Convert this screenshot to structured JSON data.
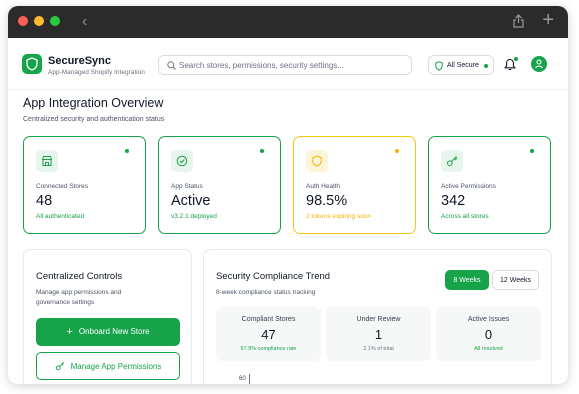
{
  "app": {
    "name": "SecureSync",
    "tagline": "App-Managed Shopify Integration",
    "search_placeholder": "Search stores, permissions, security settings...",
    "status_label": "All Secure",
    "accent": "#16a34a",
    "warning": "#f5b400"
  },
  "overview": {
    "title": "App Integration Overview",
    "subtitle": "Centralized security and authentication status",
    "cards": [
      {
        "icon": "store-icon",
        "label": "Connected Stores",
        "value": "48",
        "sub": "All authenticated",
        "status": "ok"
      },
      {
        "icon": "check-circle-icon",
        "label": "App Status",
        "value": "Active",
        "sub": "v3.2.1 deployed",
        "status": "ok"
      },
      {
        "icon": "shield-icon",
        "label": "Auth Health",
        "value": "98.5%",
        "sub": "2 tokens expiring soon",
        "status": "warning"
      },
      {
        "icon": "key-icon",
        "label": "Active Permissions",
        "value": "342",
        "sub": "Across all stores",
        "status": "ok"
      }
    ]
  },
  "controls": {
    "title": "Centralized Controls",
    "description": "Manage app permissions and governance settings",
    "primary_button": "Onboard New Store",
    "secondary_button": "Manage App Permissions"
  },
  "trend": {
    "title": "Security Compliance Trend",
    "subtitle": "8-week compliance status tracking",
    "tabs": [
      {
        "label": "8 Weeks",
        "active": true
      },
      {
        "label": "12 Weeks",
        "active": false
      }
    ],
    "stats": [
      {
        "label": "Compliant Stores",
        "value": "47",
        "sub": "97.9% compliance rate"
      },
      {
        "label": "Under Review",
        "value": "1",
        "sub": "2.1% of total"
      },
      {
        "label": "Active Issues",
        "value": "0",
        "sub": "All resolved"
      }
    ],
    "axis_first_tick": "60"
  }
}
